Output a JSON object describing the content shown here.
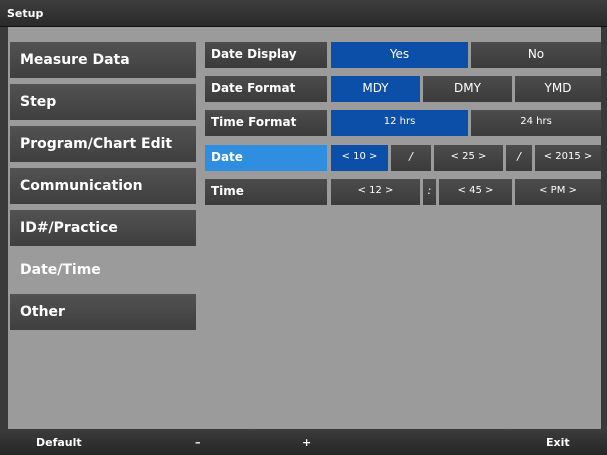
{
  "window": {
    "title": "Setup"
  },
  "sidebar": {
    "items": [
      {
        "label": "Measure Data",
        "active": false
      },
      {
        "label": "Step",
        "active": false
      },
      {
        "label": "Program/Chart Edit",
        "active": false
      },
      {
        "label": "Communication",
        "active": false
      },
      {
        "label": "ID#/Practice",
        "active": false
      },
      {
        "label": "Date/Time",
        "active": true
      },
      {
        "label": "Other",
        "active": false
      }
    ]
  },
  "settings": {
    "date_display": {
      "label": "Date Display",
      "options": [
        "Yes",
        "No"
      ],
      "selected": "Yes"
    },
    "date_format": {
      "label": "Date Format",
      "options": [
        "MDY",
        "DMY",
        "YMD"
      ],
      "selected": "MDY"
    },
    "time_format": {
      "label": "Time Format",
      "options": [
        "12 hrs",
        "24 hrs"
      ],
      "selected": "12 hrs"
    },
    "date": {
      "label": "Date",
      "month": "< 10 >",
      "day": "< 25 >",
      "year": "< 2015 >",
      "separator": "/"
    },
    "time": {
      "label": "Time",
      "hour": "< 12 >",
      "minute": "< 45 >",
      "ampm": "< PM >",
      "separator": ":"
    }
  },
  "footer": {
    "default_label": "Default",
    "minus_label": "–",
    "plus_label": "+",
    "exit_label": "Exit"
  },
  "colors": {
    "background": "#9b9b9b",
    "panel": "#474747",
    "selected": "#0b4fa8",
    "highlight": "#2f8ee0"
  }
}
